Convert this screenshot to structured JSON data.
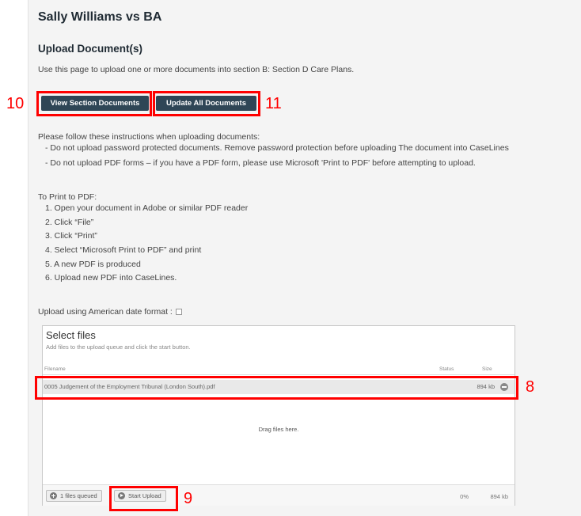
{
  "case": {
    "title": "Sally Williams vs BA"
  },
  "page": {
    "heading": "Upload Document(s)",
    "intro": "Use this page to upload one or more documents into section B: Section D Care Plans."
  },
  "buttons": {
    "view_section": "View Section Documents",
    "update_all": "Update All Documents"
  },
  "instructions": {
    "header": "Please follow these instructions when uploading documents:",
    "rules": [
      "- Do not upload password protected documents. Remove password protection before uploading The document into CaseLines",
      "- Do not upload PDF forms – if you have a PDF form, please use Microsoft 'Print to PDF' before attempting to upload."
    ],
    "print_header": "To Print to PDF:",
    "steps": [
      "1. Open your document in Adobe or similar PDF reader",
      "2. Click “File”",
      "3. Click “Print”",
      "4. Select “Microsoft Print to PDF” and print",
      "5. A new PDF is produced",
      "6. Upload new PDF into CaseLines."
    ]
  },
  "date_format": {
    "label": "Upload using American date format :",
    "checked": false
  },
  "uploader": {
    "title": "Select files",
    "subtitle": "Add files to the upload queue and click the start button.",
    "columns": {
      "filename": "Filename",
      "status": "Status",
      "size": "Size"
    },
    "files": [
      {
        "name": "0005 Judgement of the Employment Tribunal (London South).pdf",
        "size": "894 kb"
      }
    ],
    "dropzone": "Drag files here.",
    "queued_label": "1 files queued",
    "start_label": "Start Upload",
    "percent": "0%",
    "total_size": "894 kb"
  },
  "annotations": {
    "n8": "8",
    "n9": "9",
    "n10": "10",
    "n11": "11",
    "color": "#ff0000"
  },
  "colors": {
    "button_bg": "#2f4656",
    "panel_bg": "#f4f4f4"
  }
}
